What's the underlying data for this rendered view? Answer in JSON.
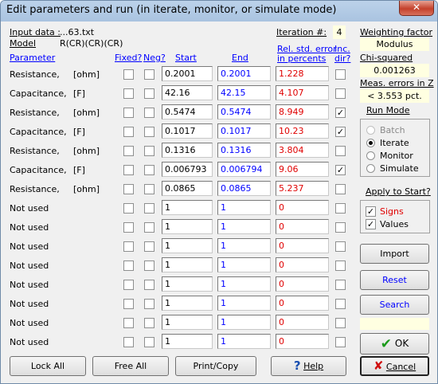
{
  "window": {
    "title": "Edit parameters and run (in iterate, monitor, or simulate mode)",
    "close_glyph": "✕"
  },
  "header": {
    "input_data_label": "Input data :",
    "input_data_value": "...63.txt",
    "model_label": "Model",
    "model_value": "R(CR)(CR)(CR)",
    "iteration_label": "Iteration #:",
    "iteration_value": "4"
  },
  "columns": {
    "parameter": "Parameter",
    "fixed": "Fixed?",
    "neg": "Neg?",
    "start": "Start",
    "end": "End",
    "rel_err_line1": "Rel. std. error",
    "rel_err_line2": "in percents",
    "inc_line1": "Inc.",
    "inc_line2": "dir?"
  },
  "rows": [
    {
      "name": "Resistance,",
      "unit": "[ohm]",
      "fixed": false,
      "neg": false,
      "start": "0.2001",
      "end": "0.2001",
      "err": "1.228",
      "inc": false
    },
    {
      "name": "Capacitance,",
      "unit": "[F]",
      "fixed": false,
      "neg": false,
      "start": "42.16",
      "end": "42.15",
      "err": "4.107",
      "inc": false
    },
    {
      "name": "Resistance,",
      "unit": "[ohm]",
      "fixed": false,
      "neg": false,
      "start": "0.5474",
      "end": "0.5474",
      "err": "8.949",
      "inc": true
    },
    {
      "name": "Capacitance,",
      "unit": "[F]",
      "fixed": false,
      "neg": false,
      "start": "0.1017",
      "end": "0.1017",
      "err": "10.23",
      "inc": true
    },
    {
      "name": "Resistance,",
      "unit": "[ohm]",
      "fixed": false,
      "neg": false,
      "start": "0.1316",
      "end": "0.1316",
      "err": "3.804",
      "inc": false
    },
    {
      "name": "Capacitance,",
      "unit": "[F]",
      "fixed": false,
      "neg": false,
      "start": "0.006793",
      "end": "0.006794",
      "err": "9.06",
      "inc": true
    },
    {
      "name": "Resistance,",
      "unit": "[ohm]",
      "fixed": false,
      "neg": false,
      "start": "0.0865",
      "end": "0.0865",
      "err": "5.237",
      "inc": false
    },
    {
      "name": "Not used",
      "unit": "",
      "fixed": false,
      "neg": false,
      "start": "1",
      "end": "1",
      "err": "0",
      "inc": false
    },
    {
      "name": "Not used",
      "unit": "",
      "fixed": false,
      "neg": false,
      "start": "1",
      "end": "1",
      "err": "0",
      "inc": false
    },
    {
      "name": "Not used",
      "unit": "",
      "fixed": false,
      "neg": false,
      "start": "1",
      "end": "1",
      "err": "0",
      "inc": false
    },
    {
      "name": "Not used",
      "unit": "",
      "fixed": false,
      "neg": false,
      "start": "1",
      "end": "1",
      "err": "0",
      "inc": false
    },
    {
      "name": "Not used",
      "unit": "",
      "fixed": false,
      "neg": false,
      "start": "1",
      "end": "1",
      "err": "0",
      "inc": false
    },
    {
      "name": "Not used",
      "unit": "",
      "fixed": false,
      "neg": false,
      "start": "1",
      "end": "1",
      "err": "0",
      "inc": false
    },
    {
      "name": "Not used",
      "unit": "",
      "fixed": false,
      "neg": false,
      "start": "1",
      "end": "1",
      "err": "0",
      "inc": false
    },
    {
      "name": "Not used",
      "unit": "",
      "fixed": false,
      "neg": false,
      "start": "1",
      "end": "1",
      "err": "0",
      "inc": false
    }
  ],
  "side": {
    "weighting_label": "Weighting factor",
    "weighting_value": "Modulus",
    "chi_label": "Chi-squared",
    "chi_value": "0.001263",
    "meas_label": "Meas. errors in Z",
    "meas_value": "< 3.553 pct.",
    "run_mode_label": "Run Mode",
    "run_modes": [
      {
        "label": "Batch",
        "checked": false,
        "disabled": true
      },
      {
        "label": "Iterate",
        "checked": true,
        "disabled": false
      },
      {
        "label": "Monitor",
        "checked": false,
        "disabled": false
      },
      {
        "label": "Simulate",
        "checked": false,
        "disabled": false
      }
    ],
    "apply_label": "Apply to Start?",
    "apply_signs": "Signs",
    "apply_values": "Values",
    "import_label": "Import",
    "reset_label": "Reset",
    "search_label": "Search",
    "ok_label": "OK"
  },
  "bottom": {
    "lock_all": "Lock All",
    "free_all": "Free All",
    "print_copy": "Print/Copy",
    "help": "Help",
    "cancel": "Cancel"
  },
  "colors": {
    "link_blue": "#0000ff",
    "error_red": "#e00000",
    "info_yellow": "#ffffe1",
    "check_green": "#1a9a1a",
    "cancel_red": "#d01010"
  }
}
